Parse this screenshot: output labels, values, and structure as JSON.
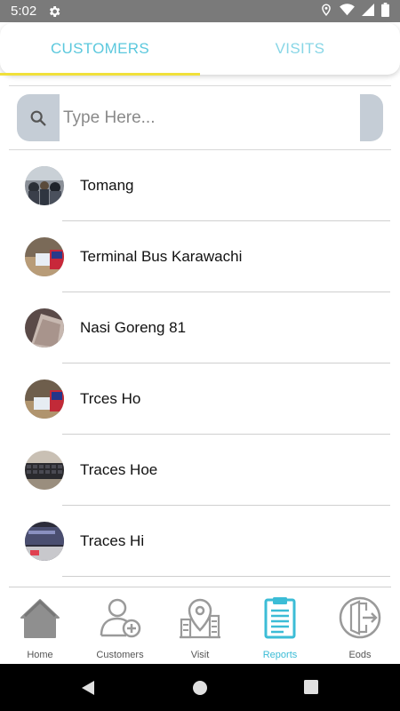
{
  "status_bar": {
    "time": "5:02",
    "icons": [
      "gear-icon",
      "location-icon",
      "wifi-icon",
      "signal-icon",
      "battery-icon"
    ]
  },
  "tabs": [
    {
      "label": "CUSTOMERS",
      "active": true
    },
    {
      "label": "VISITS",
      "active": false
    }
  ],
  "search": {
    "placeholder": "Type Here...",
    "value": ""
  },
  "customers": [
    {
      "name": "Tomang",
      "avatar": "crowd-photo"
    },
    {
      "name": "Terminal Bus Karawachi",
      "avatar": "desk-photo"
    },
    {
      "name": "Nasi Goreng 81",
      "avatar": "blurry-photo"
    },
    {
      "name": "Trces Ho",
      "avatar": "desk-photo"
    },
    {
      "name": "Traces Hoe",
      "avatar": "keyboard-photo"
    },
    {
      "name": "Traces Hi",
      "avatar": "screen-photo"
    }
  ],
  "bottom_nav": [
    {
      "label": "Home",
      "icon": "home-icon",
      "active": false
    },
    {
      "label": "Customers",
      "icon": "add-user-icon",
      "active": false
    },
    {
      "label": "Visit",
      "icon": "map-pin-icon",
      "active": false
    },
    {
      "label": "Reports",
      "icon": "clipboard-icon",
      "active": true
    },
    {
      "label": "Eods",
      "icon": "exit-door-icon",
      "active": false
    }
  ],
  "colors": {
    "accent": "#3bbcd6",
    "tab_indicator": "#f0e03a",
    "status_bar": "#7a7a7a",
    "search_addon": "#c5cdd6"
  }
}
